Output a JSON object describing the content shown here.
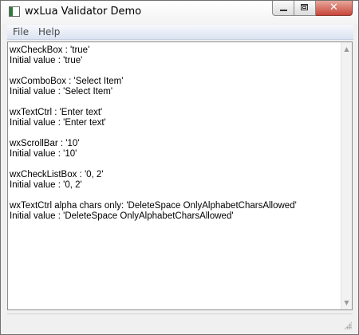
{
  "window": {
    "title": "wxLua Validator Demo",
    "icon": "app-window-icon",
    "controls": {
      "minimize": "minimize-icon",
      "maximize": "maximize-icon",
      "close": "close-icon"
    }
  },
  "menu": {
    "file": "File",
    "help": "Help"
  },
  "output_lines": [
    "wxCheckBox  : 'true'",
    "Initial value : 'true'",
    "",
    "wxComboBox  : 'Select Item'",
    "Initial value : 'Select Item'",
    "",
    "wxTextCtrl  : 'Enter text'",
    "Initial value : 'Enter text'",
    "",
    "wxScrollBar : '10'",
    "Initial value : '10'",
    "",
    "wxCheckListBox : '0, 2'",
    "Initial value : '0, 2'",
    "",
    "wxTextCtrl alpha chars only: 'DeleteSpace OnlyAlphabetCharsAllowed'",
    "Initial value : 'DeleteSpace OnlyAlphabetCharsAllowed'"
  ],
  "scrollbar": {
    "up_arrow": "▲",
    "down_arrow": "▼"
  },
  "status_text": ""
}
